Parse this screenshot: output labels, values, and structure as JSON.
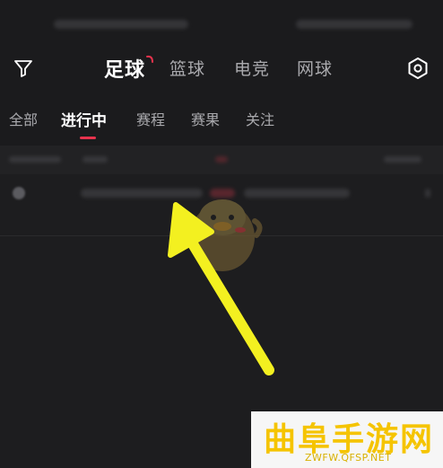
{
  "header": {
    "sport_tabs": [
      {
        "label": "足球",
        "active": true
      },
      {
        "label": "篮球",
        "active": false
      },
      {
        "label": "电竞",
        "active": false
      },
      {
        "label": "网球",
        "active": false
      }
    ],
    "filter_icon": "filter-icon",
    "settings_icon": "settings-icon"
  },
  "subtabs": [
    {
      "label": "全部",
      "active": false
    },
    {
      "label": "进行中",
      "active": true
    },
    {
      "label": "赛程",
      "active": false
    },
    {
      "label": "赛果",
      "active": false
    },
    {
      "label": "关注",
      "active": false
    }
  ],
  "annotation": {
    "arrow_color": "#f3f020"
  },
  "watermark": {
    "title": "曲阜手游网",
    "url": "ZWFW.QFSP.NET"
  },
  "colors": {
    "background": "#1d1d1f",
    "accent": "#e8334d",
    "watermark_yellow": "#f5c400"
  }
}
